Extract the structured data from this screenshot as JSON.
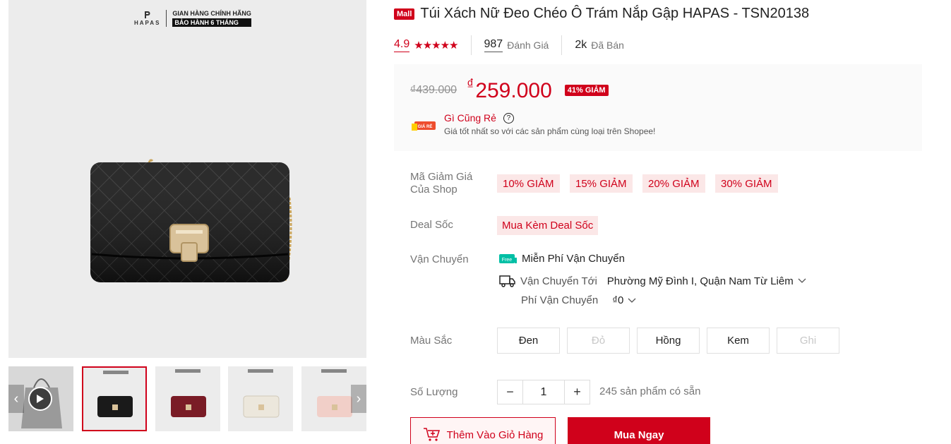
{
  "gallery": {
    "brand": "HAPAS",
    "store_line1": "GIAN HÀNG CHÍNH HÃNG",
    "store_line2": "BẢO HÀNH 6 THÁNG",
    "thumbnail_colors": [
      "#a3a3a3",
      "#1a1a1a",
      "#7a1c26",
      "#ece7dc",
      "#f1cfc8"
    ]
  },
  "product": {
    "mall_badge": "Mall",
    "title": "Túi Xách Nữ Đeo Chéo Ô Trám Nắp Gập HAPAS - TSN20138",
    "rating": "4.9",
    "stars": "★★★★★",
    "review_count": "987",
    "review_label": "Đánh Giá",
    "sold_count": "2k",
    "sold_label": "Đã Bán"
  },
  "price": {
    "original": "₫439.000",
    "currency": "₫",
    "current": "259.000",
    "discount": "41% GIẢM",
    "cheap_logo_text": "GIÁ RẺ",
    "cheap_title": "Gì Cũng Rẻ",
    "help": "?",
    "cheap_sub": "Giá tốt nhất so với các sản phẩm cùng loại trên Shopee!"
  },
  "vouchers": {
    "label": "Mã Giảm Giá Của Shop",
    "items": [
      "10% GIẢM",
      "15% GIẢM",
      "20% GIẢM",
      "30% GIẢM"
    ]
  },
  "deal": {
    "label": "Deal Sốc",
    "tag": "Mua Kèm Deal Sốc"
  },
  "shipping": {
    "label": "Vận Chuyển",
    "free_icon_text": "Free",
    "free_text": "Miễn Phí Vận Chuyển",
    "to_label": "Vận Chuyển Tới",
    "to_address": "Phường Mỹ Đình I, Quận Nam Từ Liêm",
    "fee_label": "Phí Vận Chuyển",
    "fee_value": "₫0"
  },
  "colors": {
    "label": "Màu Sắc",
    "options": [
      {
        "label": "Đen",
        "disabled": false
      },
      {
        "label": "Đỏ",
        "disabled": true
      },
      {
        "label": "Hồng",
        "disabled": false
      },
      {
        "label": "Kem",
        "disabled": false
      },
      {
        "label": "Ghi",
        "disabled": true
      }
    ]
  },
  "quantity": {
    "label": "Số Lượng",
    "minus": "−",
    "value": "1",
    "plus": "+",
    "stock": "245 sản phẩm có sẵn"
  },
  "actions": {
    "add_to_cart": "Thêm Vào Giỏ Hàng",
    "buy_now": "Mua Ngay"
  },
  "theme": {
    "accent": "#d0011b",
    "voucher_bg": "#fbe7e7"
  }
}
